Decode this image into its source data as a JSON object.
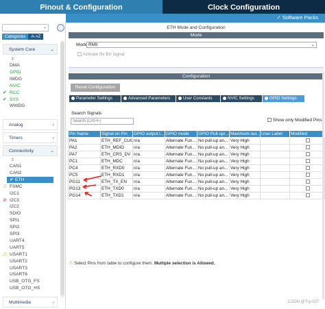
{
  "tabs": {
    "pinout": "Pinout & Configuration",
    "clock": "Clock Configuration"
  },
  "software_packs": "✓ Software Packs",
  "left": {
    "search_value": "",
    "categories_tab": "Categories",
    "az_tab": "A->Z",
    "system_core": {
      "label": "System Core",
      "items": [
        {
          "label": "DMA",
          "status": "none"
        },
        {
          "label": "GPIO",
          "status": "green"
        },
        {
          "label": "IWDG",
          "status": "none"
        },
        {
          "label": "NVIC",
          "status": "green"
        },
        {
          "label": "RCC",
          "status": "check"
        },
        {
          "label": "SYS",
          "status": "check"
        },
        {
          "label": "WWDG",
          "status": "none"
        }
      ]
    },
    "analog": "Analog",
    "timers": "Timers",
    "connectivity": {
      "label": "Connectivity",
      "items": [
        {
          "label": "CAN1",
          "status": "none"
        },
        {
          "label": "CAN2",
          "status": "none"
        },
        {
          "label": "ETH",
          "status": "check-selected"
        },
        {
          "label": "FSMC",
          "status": "warn"
        },
        {
          "label": "I2C1",
          "status": "none"
        },
        {
          "label": "I2C3",
          "status": "disabled"
        },
        {
          "label": "I2C2",
          "status": "none"
        },
        {
          "label": "SDIO",
          "status": "none"
        },
        {
          "label": "SPI1",
          "status": "none"
        },
        {
          "label": "SPI2",
          "status": "none"
        },
        {
          "label": "SPI3",
          "status": "none"
        },
        {
          "label": "UART4",
          "status": "none"
        },
        {
          "label": "UART5",
          "status": "none"
        },
        {
          "label": "USART1",
          "status": "warn"
        },
        {
          "label": "USART2",
          "status": "none"
        },
        {
          "label": "USART3",
          "status": "none"
        },
        {
          "label": "USART6",
          "status": "none"
        },
        {
          "label": "USB_OTG_FS",
          "status": "none"
        },
        {
          "label": "USB_OTG_HS",
          "status": "none"
        }
      ]
    },
    "multimedia": "Multimedia"
  },
  "right": {
    "title": "ETH Mode and Configuration",
    "mode_bar": "Mode",
    "mode_label": "Mode",
    "mode_value": "RMII",
    "activate_label": "Activate Rx Err signal",
    "config_bar": "Configuration",
    "reset_button": "Reset Configuration",
    "subtabs": [
      "Parameter Settings",
      "Advanced Parameters",
      "User Constants",
      "NVIC Settings",
      "GPIO Settings"
    ],
    "search_label": "Search Signals",
    "search_placeholder": "Search (CrtI+F)",
    "show_modified": "Show only Modified Pins",
    "columns": [
      "Pin Name",
      "Signal on Pin",
      "GPIO output l...",
      "GPIO mode",
      "GPIO Pull-up/...",
      "Maximum out...",
      "User Label",
      "Modified"
    ],
    "rows": [
      [
        "PA1",
        "ETH_REF_CLK",
        "n/a",
        "Alternate Fun...",
        "No pull-up an...",
        "Very High",
        "",
        ""
      ],
      [
        "PA2",
        "ETH_MDIO",
        "n/a",
        "Alternate Fun...",
        "No pull-up an...",
        "Very High",
        "",
        ""
      ],
      [
        "PA7",
        "ETH_CRS_DV",
        "n/a",
        "Alternate Fun...",
        "No pull-up an...",
        "Very High",
        "",
        ""
      ],
      [
        "PC1",
        "ETH_MDC",
        "n/a",
        "Alternate Fun...",
        "No pull-up an...",
        "Very High",
        "",
        ""
      ],
      [
        "PC4",
        "ETH_RXD0",
        "n/a",
        "Alternate Fun...",
        "No pull-up an...",
        "Very High",
        "",
        ""
      ],
      [
        "PC5",
        "ETH_RXD1",
        "n/a",
        "Alternate Fun...",
        "No pull-up an...",
        "Very High",
        "",
        ""
      ],
      [
        "PG11",
        "ETH_TX_EN",
        "n/a",
        "Alternate Fun...",
        "No pull-up an...",
        "Very High",
        "",
        ""
      ],
      [
        "PG13",
        "ETH_TXD0",
        "n/a",
        "Alternate Fun...",
        "No pull-up an...",
        "Very High",
        "",
        ""
      ],
      [
        "PG14",
        "ETH_TXD1",
        "n/a",
        "Alternate Fun...",
        "No pull-up an...",
        "Very High",
        "",
        ""
      ]
    ],
    "hint_prefix": "Select Pins from table to configure them.",
    "hint_bold": "Multiple selection is Allowed."
  },
  "watermark": "CSDN @Try-027",
  "colors": {
    "accent": "#3a8fc6",
    "dark_tab": "#0d2b45",
    "green": "#2c9a3c",
    "warn": "#e0a400",
    "annotation_red": "#e02020"
  }
}
